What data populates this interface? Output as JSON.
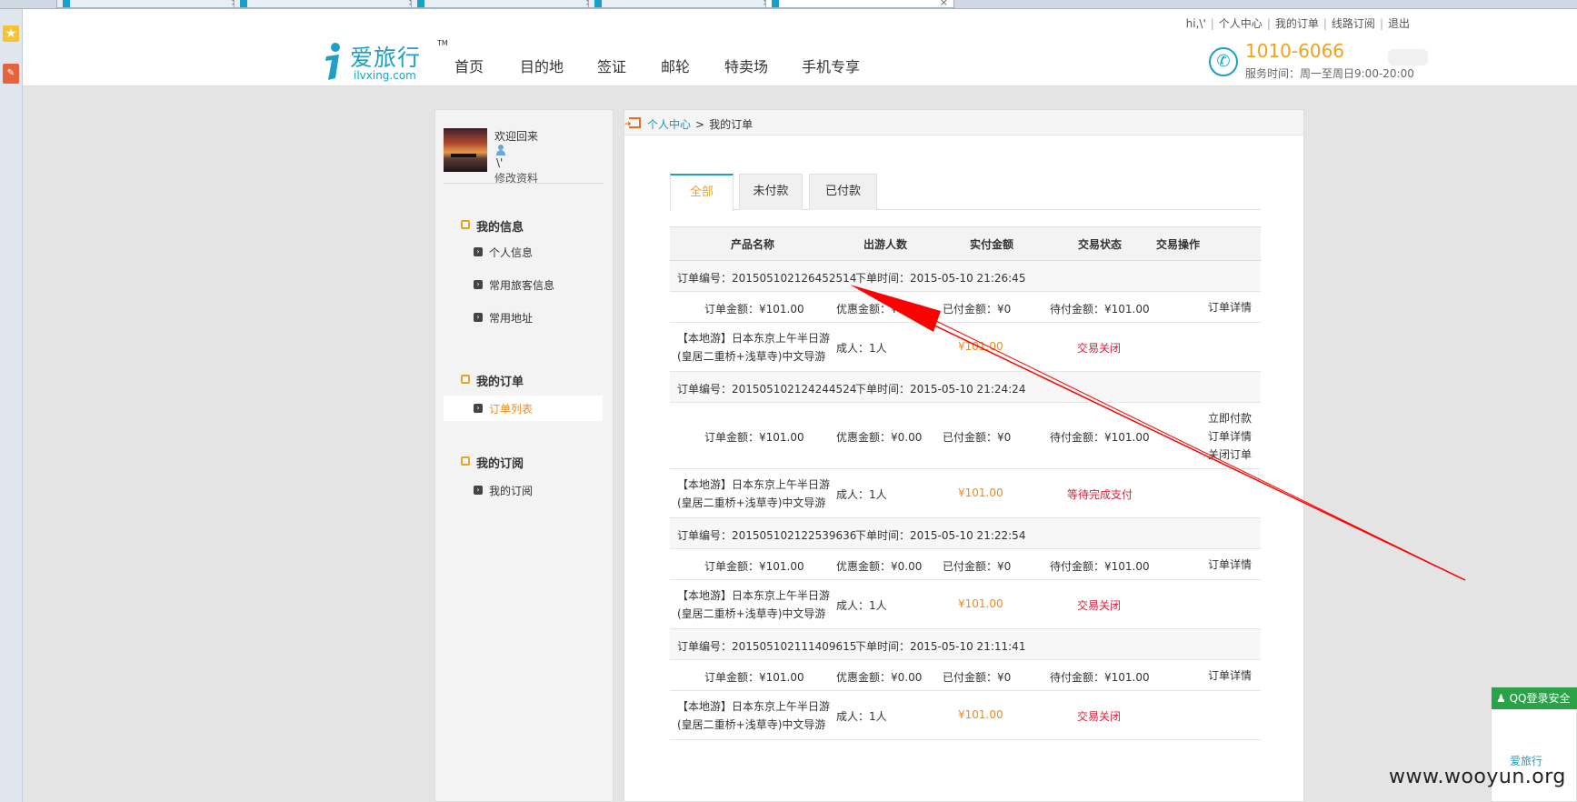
{
  "header": {
    "top_links": [
      "hi,\\'",
      "个人中心",
      "我的订单",
      "线路订阅",
      "退出"
    ],
    "logo_cn": "爱旅行",
    "logo_tm": "TM",
    "logo_en": "ilvxing.com",
    "nav": [
      "首页",
      "目的地",
      "签证",
      "邮轮",
      "特卖场",
      "手机专享"
    ],
    "phone": "1010-6066",
    "service_hours": "服务时间：周一至周日9:00-20:00"
  },
  "sidebar": {
    "welcome": "欢迎回来",
    "username": "\\'",
    "edit_profile": "修改资料",
    "sections": [
      {
        "title": "我的信息",
        "items": [
          "个人信息",
          "常用旅客信息",
          "常用地址"
        ]
      },
      {
        "title": "我的订单",
        "items": [
          "订单列表"
        ]
      },
      {
        "title": "我的订阅",
        "items": [
          "我的订阅"
        ]
      }
    ],
    "active_item": "订单列表"
  },
  "breadcrumb": {
    "link": "个人中心",
    "sep": ">",
    "current": "我的订单"
  },
  "tabs": [
    "全部",
    "未付款",
    "已付款"
  ],
  "table": {
    "headers": [
      "产品名称",
      "出游人数",
      "实付金额",
      "交易状态",
      "交易操作"
    ],
    "orders": [
      {
        "order_no": "订单编号：201505102126452514",
        "order_time": "下单时间：2015-05-10 21:26:45",
        "total": "订单金额：¥101.00",
        "discount": "优惠金额：¥0.00",
        "paid": "已付金额：¥0",
        "due": "待付金额：¥101.00",
        "ops": [
          "订单详情"
        ],
        "product": "【本地游】日本东京上午半日游(皇居二重桥+浅草寺)中文导游",
        "people": "成人：1人",
        "amount": "¥101.00",
        "status": "交易关闭"
      },
      {
        "order_no": "订单编号：201505102124244524",
        "order_time": "下单时间：2015-05-10 21:24:24",
        "total": "订单金额：¥101.00",
        "discount": "优惠金额：¥0.00",
        "paid": "已付金额：¥0",
        "due": "待付金额：¥101.00",
        "ops": [
          "立即付款",
          "订单详情",
          "关闭订单"
        ],
        "product": "【本地游】日本东京上午半日游(皇居二重桥+浅草寺)中文导游",
        "people": "成人：1人",
        "amount": "¥101.00",
        "status": "等待完成支付"
      },
      {
        "order_no": "订单编号：201505102122539636",
        "order_time": "下单时间：2015-05-10 21:22:54",
        "total": "订单金额：¥101.00",
        "discount": "优惠金额：¥0.00",
        "paid": "已付金额：¥0",
        "due": "待付金额：¥101.00",
        "ops": [
          "订单详情"
        ],
        "product": "【本地游】日本东京上午半日游(皇居二重桥+浅草寺)中文导游",
        "people": "成人：1人",
        "amount": "¥101.00",
        "status": "交易关闭"
      },
      {
        "order_no": "订单编号：201505102111409615",
        "order_time": "下单时间：2015-05-10 21:11:41",
        "total": "订单金额：¥101.00",
        "discount": "优惠金额：¥0.00",
        "paid": "已付金额：¥0",
        "due": "待付金额：¥101.00",
        "ops": [
          "订单详情"
        ],
        "product": "【本地游】日本东京上午半日游(皇居二重桥+浅草寺)中文导游",
        "people": "成人：1人",
        "amount": "¥101.00",
        "status": "交易关闭"
      }
    ]
  },
  "qq_widget": {
    "label": "QQ登录安全",
    "logo": "爱旅行"
  },
  "watermark": "www.wooyun.org",
  "colors": {
    "brand": "#1da0c3",
    "accent": "#f0a21c",
    "status_red": "#e0203a",
    "annotation": "#ff0000"
  }
}
